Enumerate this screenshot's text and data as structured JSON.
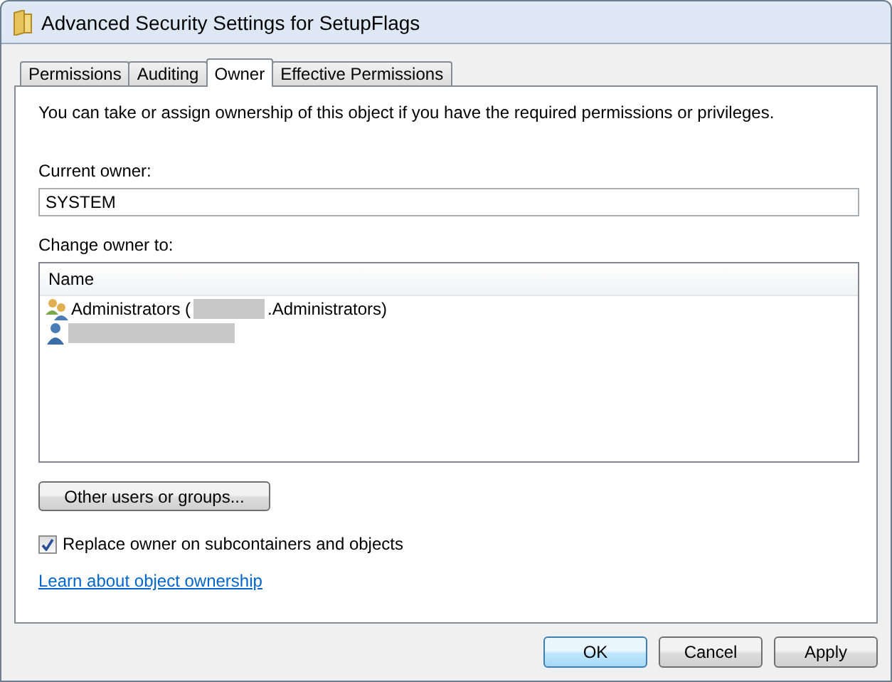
{
  "window": {
    "title": "Advanced Security Settings for SetupFlags"
  },
  "tabs": [
    {
      "label": "Permissions",
      "selected": false
    },
    {
      "label": "Auditing",
      "selected": false
    },
    {
      "label": "Owner",
      "selected": true
    },
    {
      "label": "Effective Permissions",
      "selected": false
    }
  ],
  "intro": "You can take or assign ownership of this object if you have the required permissions or privileges.",
  "current_owner": {
    "label": "Current owner:",
    "value": "SYSTEM"
  },
  "change_owner": {
    "label": "Change owner to:",
    "column": "Name",
    "rows": [
      {
        "kind": "group",
        "text_before": "Administrators (",
        "text_after": ".Administrators)",
        "selected": false
      },
      {
        "kind": "user",
        "selected": false
      }
    ]
  },
  "other_button": "Other users or groups...",
  "replace_checkbox": {
    "label": "Replace owner on subcontainers and objects",
    "checked": true
  },
  "link": "Learn about object ownership",
  "buttons": [
    {
      "label": "OK",
      "default": true
    },
    {
      "label": "Cancel",
      "default": false
    },
    {
      "label": "Apply",
      "default": false
    }
  ]
}
